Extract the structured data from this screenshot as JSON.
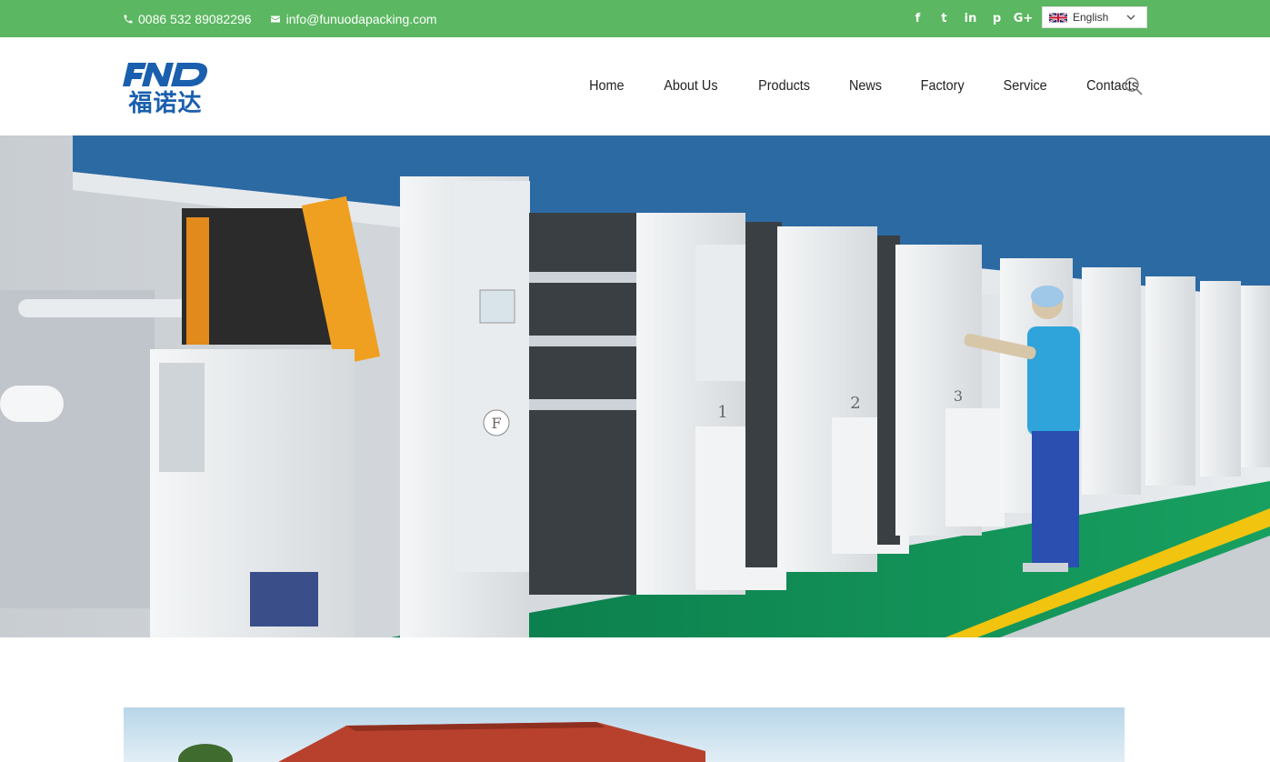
{
  "topbar": {
    "phone": "0086 532 89082296",
    "email": "info@funuodapacking.com",
    "social": [
      "f",
      "t",
      "in",
      "p",
      "G+"
    ],
    "language": "English",
    "bg_color": "#5bb761"
  },
  "logo": {
    "latin": "FND",
    "chinese": "福诺达",
    "color": "#1a5fae"
  },
  "nav": {
    "items": [
      "Home",
      "About Us",
      "Products",
      "News",
      "Factory",
      "Service",
      "Contacts"
    ]
  },
  "icons": {
    "phone": "phone-icon",
    "email": "envelope-icon",
    "search": "search-icon",
    "dropdown": "chevron-down-icon"
  },
  "hero": {
    "panel_labels": [
      "F",
      "1",
      "2",
      "3"
    ]
  }
}
